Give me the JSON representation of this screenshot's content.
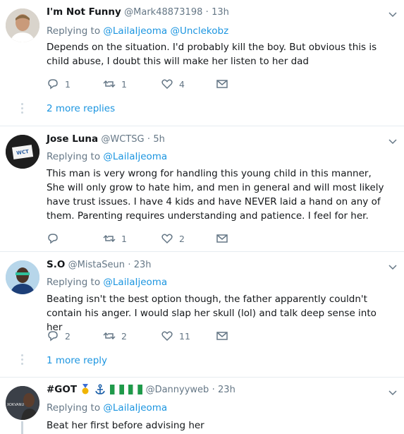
{
  "tweets": [
    {
      "name": "I'm Not Funny",
      "handle": "@Mark48873198",
      "dot": "·",
      "time": "13h",
      "replying_prefix": "Replying to",
      "mentions": [
        "@LailaIjeoma",
        "@Unclekobz"
      ],
      "text": "Depends on the situation.  I'd probably kill the boy.  But obvious this is child abuse, I doubt this will make her listen to her dad",
      "reply_count": "1",
      "retweet_count": "1",
      "like_count": "4",
      "more_replies": "2 more replies"
    },
    {
      "name": "Jose Luna",
      "handle": "@WCTSG",
      "dot": "·",
      "time": "5h",
      "replying_prefix": "Replying to",
      "mentions": [
        "@LailaIjeoma"
      ],
      "text": "This man is very wrong for handling this young child in this manner, She will only grow to hate him, and men in general and will most likely have trust issues. I have 4 kids and have NEVER laid a hand on any of them. Parenting requires understanding and patience. I feel for her.",
      "reply_count": "",
      "retweet_count": "1",
      "like_count": "2",
      "avatar_text": "WCT"
    },
    {
      "name": "S.O",
      "handle": "@MistaSeun",
      "dot": "·",
      "time": "23h",
      "replying_prefix": "Replying to",
      "mentions": [
        "@LailaIjeoma"
      ],
      "text": "Beating isn't the best option though, the father apparently couldn't contain his anger. I would slap her skull (lol) and talk deep sense into her",
      "reply_count": "2",
      "retweet_count": "2",
      "like_count": "11",
      "more_replies": "1 more reply"
    },
    {
      "name": "#GOT",
      "handle": "@Dannyyweb",
      "dot": "·",
      "time": "23h",
      "replying_prefix": "Replying to",
      "mentions": [
        "@LailaIjeoma"
      ],
      "text": "Beat her first before advising her",
      "avatar_text": "XOKVANU"
    }
  ],
  "colors": {
    "link": "#1b95e0",
    "muted": "#657786",
    "divider": "#e6ecf0"
  }
}
